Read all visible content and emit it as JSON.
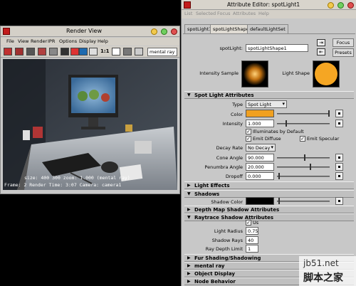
{
  "render_view": {
    "title": "Render View",
    "menus": [
      "File",
      "View",
      "Render",
      "IPR",
      "Options",
      "Display",
      "Help"
    ],
    "ratio_label": "1:1",
    "renderer": "mental ray",
    "info_line1": "size:  400  300  zoom: 1.000     (mental ray)",
    "info_line2": "Frame: 2   Render Time: 3:07   Camera: camera1"
  },
  "attribute_editor": {
    "title": "Attribute Editor: spotLight1",
    "menus": [
      "List",
      "Selected",
      "Focus",
      "Attributes",
      "Help"
    ],
    "tabs": [
      "spotLight1",
      "spotLightShape1",
      "defaultLightSet"
    ],
    "node_label": "spotLight:",
    "node_name": "spotLightShape1",
    "focus_label": "Focus",
    "presets_label": "Presets",
    "intensity_sample_label": "Intensity Sample",
    "light_shape_label": "Light Shape",
    "spot_section": "Spot Light Attributes",
    "type_label": "Type",
    "type_value": "Spot Light",
    "color_label": "Color",
    "color_hex": "#f0a020",
    "intensity_label": "Intensity",
    "intensity_value": "1.000",
    "illuminates_label": "Illuminates by Default",
    "emit_diffuse_label": "Emit Diffuse",
    "emit_specular_label": "Emit Specular",
    "decay_label": "Decay Rate",
    "decay_value": "No Decay",
    "cone_label": "Cone Angle",
    "cone_value": "90.000",
    "penumbra_label": "Penumbra Angle",
    "penumbra_value": "20.000",
    "dropoff_label": "Dropoff",
    "dropoff_value": "0.000",
    "light_effects_section": "Light Effects",
    "shadows_section": "Shadows",
    "shadow_color_label": "Shadow Color",
    "depth_map_section": "Depth Map Shadow Attributes",
    "raytrace_section": "Raytrace Shadow Attributes",
    "use_ray_label": "Us",
    "light_radius_label": "Light Radius",
    "light_radius_value": "0.750",
    "shadow_rays_label": "Shadow Rays",
    "shadow_rays_value": "40",
    "ray_depth_label": "Ray Depth Limit",
    "ray_depth_value": "1",
    "fur_section": "Fur Shading/Shadowing",
    "mental_ray_section": "mental ray",
    "object_display_section": "Object Display",
    "node_behavior_section": "Node Behavior"
  },
  "watermark": {
    "line1": "jb51.net",
    "line2": "脚本之家"
  }
}
